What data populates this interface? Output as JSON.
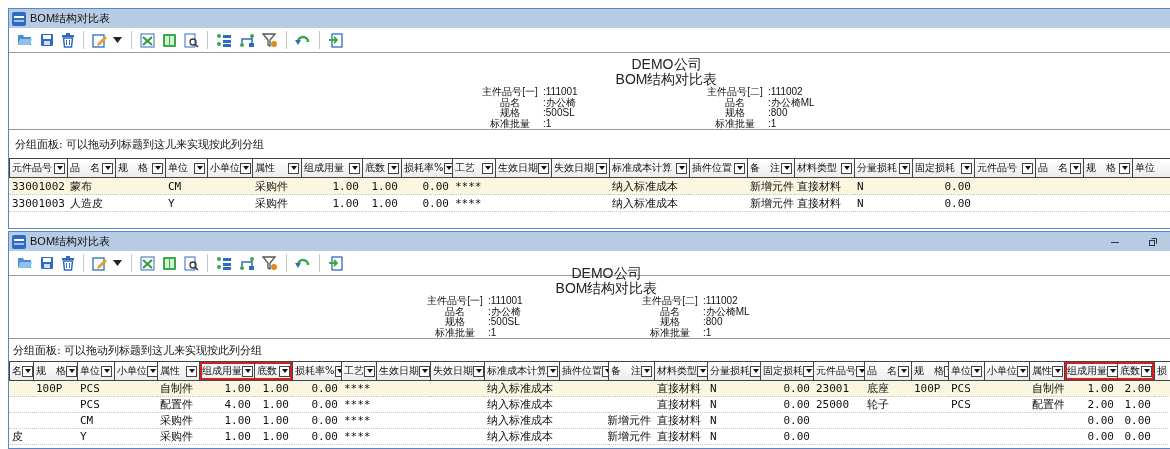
{
  "windows": [
    {
      "title": "BOM结构对比表",
      "report": {
        "company": "DEMO公司",
        "title": "BOM结构对比表",
        "blocks": [
          [
            {
              "label": "主件品号[一]",
              "value": ":111001"
            },
            {
              "label": "品名",
              "value": ":办公椅"
            },
            {
              "label": "规格",
              "value": ":500SL"
            },
            {
              "label": "标准批量",
              "value": ":1"
            }
          ],
          [
            {
              "label": "主件品号[二]",
              "value": ":111002"
            },
            {
              "label": "品名",
              "value": ":办公椅ML"
            },
            {
              "label": "规格",
              "value": ":800"
            },
            {
              "label": "标准批量",
              "value": ":1"
            }
          ]
        ]
      },
      "group_panel": "分组面板: 可以拖动列标题到这儿来实现按此列分组",
      "columns": [
        {
          "label": "元件品号",
          "highlighted": false
        },
        {
          "label": "品　名",
          "highlighted": false
        },
        {
          "label": "规　格",
          "highlighted": false
        },
        {
          "label": "单位",
          "highlighted": false
        },
        {
          "label": "小单位",
          "highlighted": false
        },
        {
          "label": "属性",
          "highlighted": false
        },
        {
          "label": "组成用量",
          "highlighted": false
        },
        {
          "label": "底数",
          "highlighted": false
        },
        {
          "label": "损耗率%",
          "highlighted": false
        },
        {
          "label": "工艺",
          "highlighted": false
        },
        {
          "label": "生效日期",
          "highlighted": false
        },
        {
          "label": "失效日期",
          "highlighted": false
        },
        {
          "label": "标准成本计算",
          "highlighted": false
        },
        {
          "label": "插件位置",
          "highlighted": false
        },
        {
          "label": "备　注",
          "highlighted": false
        },
        {
          "label": "材料类型",
          "highlighted": false
        },
        {
          "label": "分量损耗",
          "highlighted": false
        },
        {
          "label": "固定损耗",
          "highlighted": false
        },
        {
          "label": "元件品号",
          "highlighted": false
        },
        {
          "label": "品　名",
          "highlighted": false
        },
        {
          "label": "规　格",
          "highlighted": false
        },
        {
          "label": "单位",
          "highlighted": false
        }
      ],
      "rows": [
        {
          "selected": true,
          "cells": [
            "33001002",
            "蒙布",
            "",
            "CM",
            "",
            "采购件",
            "1.00",
            "1.00",
            "0.00",
            "****",
            "",
            "",
            "纳入标准成本",
            "",
            "新增元件",
            "直接材料",
            "N",
            "0.00",
            "",
            "",
            "",
            ""
          ]
        },
        {
          "selected": false,
          "cells": [
            "33001003",
            "人造皮",
            "",
            "Y",
            "",
            "采购件",
            "1.00",
            "1.00",
            "0.00",
            "****",
            "",
            "",
            "纳入标准成本",
            "",
            "新增元件",
            "直接材料",
            "N",
            "0.00",
            "",
            "",
            "",
            ""
          ]
        }
      ]
    },
    {
      "title": "BOM结构对比表",
      "report": {
        "company": "DEMO公司",
        "title": "BOM结构对比表",
        "blocks": [
          [
            {
              "label": "主件品号[一]",
              "value": ":111001"
            },
            {
              "label": "品名",
              "value": ":办公椅"
            },
            {
              "label": "规格",
              "value": ":500SL"
            },
            {
              "label": "标准批量",
              "value": ":1"
            }
          ],
          [
            {
              "label": "主件品号[二]",
              "value": ":111002"
            },
            {
              "label": "品名",
              "value": ":办公椅ML"
            },
            {
              "label": "规格",
              "value": ":800"
            },
            {
              "label": "标准批量",
              "value": ":1"
            }
          ]
        ]
      },
      "group_panel": "分组面板: 可以拖动列标题到这儿来实现按此列分组",
      "columns": [
        {
          "label": "名",
          "highlighted": false
        },
        {
          "label": "规　格",
          "highlighted": false
        },
        {
          "label": "单位",
          "highlighted": false
        },
        {
          "label": "小单位",
          "highlighted": false
        },
        {
          "label": "属性",
          "highlighted": false
        },
        {
          "label": "组成用量",
          "highlighted": true
        },
        {
          "label": "底数",
          "highlighted": true
        },
        {
          "label": "损耗率%",
          "highlighted": false
        },
        {
          "label": "工艺",
          "highlighted": false
        },
        {
          "label": "生效日期",
          "highlighted": false
        },
        {
          "label": "失效日期",
          "highlighted": false
        },
        {
          "label": "标准成本计算",
          "highlighted": false
        },
        {
          "label": "插件位置",
          "highlighted": false
        },
        {
          "label": "备　注",
          "highlighted": false
        },
        {
          "label": "材料类型",
          "highlighted": false
        },
        {
          "label": "分量损耗",
          "highlighted": false
        },
        {
          "label": "固定损耗",
          "highlighted": false
        },
        {
          "label": "元件品号",
          "highlighted": false
        },
        {
          "label": "品　名",
          "highlighted": false
        },
        {
          "label": "规　格",
          "highlighted": false
        },
        {
          "label": "单位",
          "highlighted": false
        },
        {
          "label": "小单位",
          "highlighted": false
        },
        {
          "label": "属性",
          "highlighted": false
        },
        {
          "label": "组成用量",
          "highlighted": true
        },
        {
          "label": "底数",
          "highlighted": true
        },
        {
          "label": "损",
          "highlighted": false
        }
      ],
      "rows": [
        {
          "selected": true,
          "cells": [
            "",
            "100P",
            "PCS",
            "",
            "自制件",
            "1.00",
            "1.00",
            "0.00",
            "****",
            "",
            "",
            "纳入标准成本",
            "",
            "",
            "直接材料",
            "N",
            "0.00",
            "23001",
            "底座",
            "100P",
            "PCS",
            "",
            "自制件",
            "1.00",
            "2.00",
            ""
          ]
        },
        {
          "selected": false,
          "cells": [
            "",
            "",
            "PCS",
            "",
            "配置件",
            "4.00",
            "1.00",
            "0.00",
            "****",
            "",
            "",
            "纳入标准成本",
            "",
            "",
            "直接材料",
            "N",
            "0.00",
            "25000",
            "轮子",
            "",
            "PCS",
            "",
            "配置件",
            "2.00",
            "1.00",
            ""
          ]
        },
        {
          "selected": false,
          "cells": [
            "",
            "",
            "CM",
            "",
            "采购件",
            "1.00",
            "1.00",
            "0.00",
            "****",
            "",
            "",
            "纳入标准成本",
            "",
            "新增元件",
            "直接材料",
            "N",
            "0.00",
            "",
            "",
            "",
            "",
            "",
            "",
            "0.00",
            "0.00",
            ""
          ]
        },
        {
          "selected": false,
          "cells": [
            "皮",
            "",
            "Y",
            "",
            "采购件",
            "1.00",
            "1.00",
            "0.00",
            "****",
            "",
            "",
            "纳入标准成本",
            "",
            "新增元件",
            "直接材料",
            "N",
            "0.00",
            "",
            "",
            "",
            "",
            "",
            "",
            "0.00",
            "0.00",
            ""
          ]
        }
      ]
    }
  ]
}
